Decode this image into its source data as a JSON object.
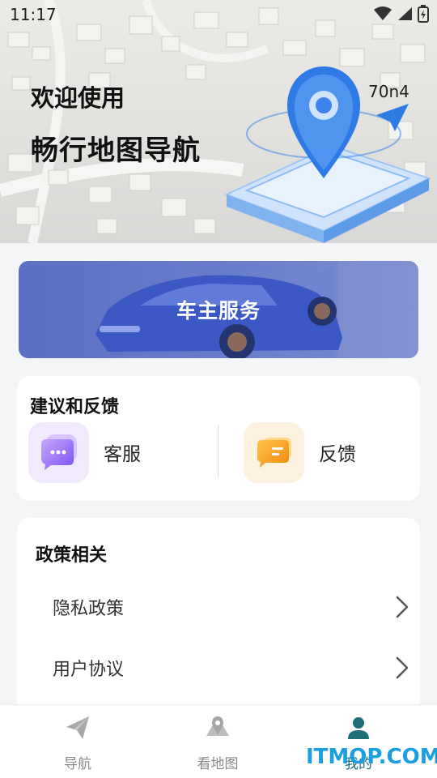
{
  "status_bar": {
    "time": "11:17"
  },
  "hero": {
    "welcome": "欢迎使用",
    "title": "畅行地图导航",
    "version": "70n4"
  },
  "car_service": {
    "label": "车主服务"
  },
  "feedback": {
    "title": "建议和反馈",
    "items": [
      {
        "label": "客服",
        "icon": "chat-bubble-icon",
        "color": "#8b6cf0"
      },
      {
        "label": "反馈",
        "icon": "message-icon",
        "color": "#f0a020"
      }
    ]
  },
  "policy": {
    "title": "政策相关",
    "rows": [
      {
        "label": "隐私政策"
      },
      {
        "label": "用户协议"
      }
    ]
  },
  "bottom_nav": {
    "items": [
      {
        "label": "导航",
        "icon": "paper-plane-icon"
      },
      {
        "label": "看地图",
        "icon": "map-pin-icon"
      },
      {
        "label": "我的",
        "icon": "user-icon",
        "active": true
      }
    ],
    "active_color": "#1f6f78"
  },
  "watermark": "ITMOP.COM"
}
